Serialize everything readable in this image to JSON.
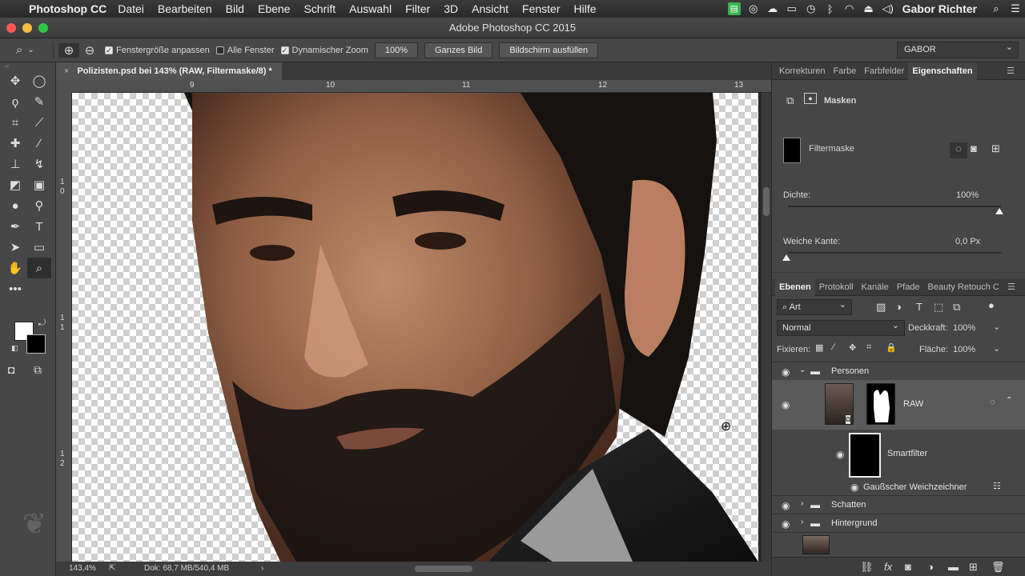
{
  "menubar": {
    "apple": "",
    "app": "Photoshop CC",
    "items": [
      "Datei",
      "Bearbeiten",
      "Bild",
      "Ebene",
      "Schrift",
      "Auswahl",
      "Filter",
      "3D",
      "Ansicht",
      "Fenster",
      "Hilfe"
    ],
    "user": "Gabor Richter"
  },
  "window": {
    "title": "Adobe Photoshop CC 2015"
  },
  "options": {
    "resize_window": "Fenstergröße anpassen",
    "resize_window_checked": true,
    "all_windows": "Alle Fenster",
    "all_windows_checked": false,
    "scrubby_zoom": "Dynamischer Zoom",
    "scrubby_zoom_checked": true,
    "zoom_value": "100%",
    "fit_screen": "Ganzes Bild",
    "fill_screen": "Bildschirm ausfüllen",
    "workspace": "GABOR"
  },
  "document": {
    "tab_title": "Polizisten.psd bei 143% (RAW, Filtermaske/8) *",
    "ruler_h": [
      "9",
      "10",
      "11",
      "12",
      "13"
    ],
    "ruler_v": [
      "1",
      "0",
      "1",
      "1",
      "1",
      "2"
    ],
    "zoom": "143,4%",
    "doc_size": "Dok: 68,7 MB/540,4 MB"
  },
  "properties_panel": {
    "tabs": [
      "Korrekturen",
      "Farbe",
      "Farbfelder",
      "Eigenschaften"
    ],
    "active_tab": "Eigenschaften",
    "section": "Masken",
    "mask_name": "Filtermaske",
    "density_label": "Dichte:",
    "density_value": "100%",
    "density": 1.0,
    "feather_label": "Weiche Kante:",
    "feather_value": "0,0 Px",
    "feather": 0.0
  },
  "layers_panel": {
    "tabs": [
      "Ebenen",
      "Protokoll",
      "Kanäle",
      "Pfade",
      "Beauty Retouch C"
    ],
    "active_tab": "Ebenen",
    "filter_kind": "Art",
    "blend_mode": "Normal",
    "opacity_label": "Deckkraft:",
    "opacity_value": "100%",
    "lock_label": "Fixieren:",
    "fill_label": "Fläche:",
    "fill_value": "100%",
    "layers": [
      {
        "name": "Personen",
        "type": "group",
        "expanded": true
      },
      {
        "name": "RAW",
        "type": "smart-object"
      },
      {
        "name": "Smartfilter",
        "type": "smart-filter"
      },
      {
        "name": "Gaußscher Weichzeichner",
        "type": "filter"
      },
      {
        "name": "Schatten",
        "type": "group",
        "expanded": false
      },
      {
        "name": "Hintergrund",
        "type": "group",
        "expanded": false
      }
    ]
  },
  "colors": {
    "panel_bg": "#464646",
    "canvas_bg": "#282828",
    "foreground": "#ffffff",
    "background": "#000000"
  }
}
